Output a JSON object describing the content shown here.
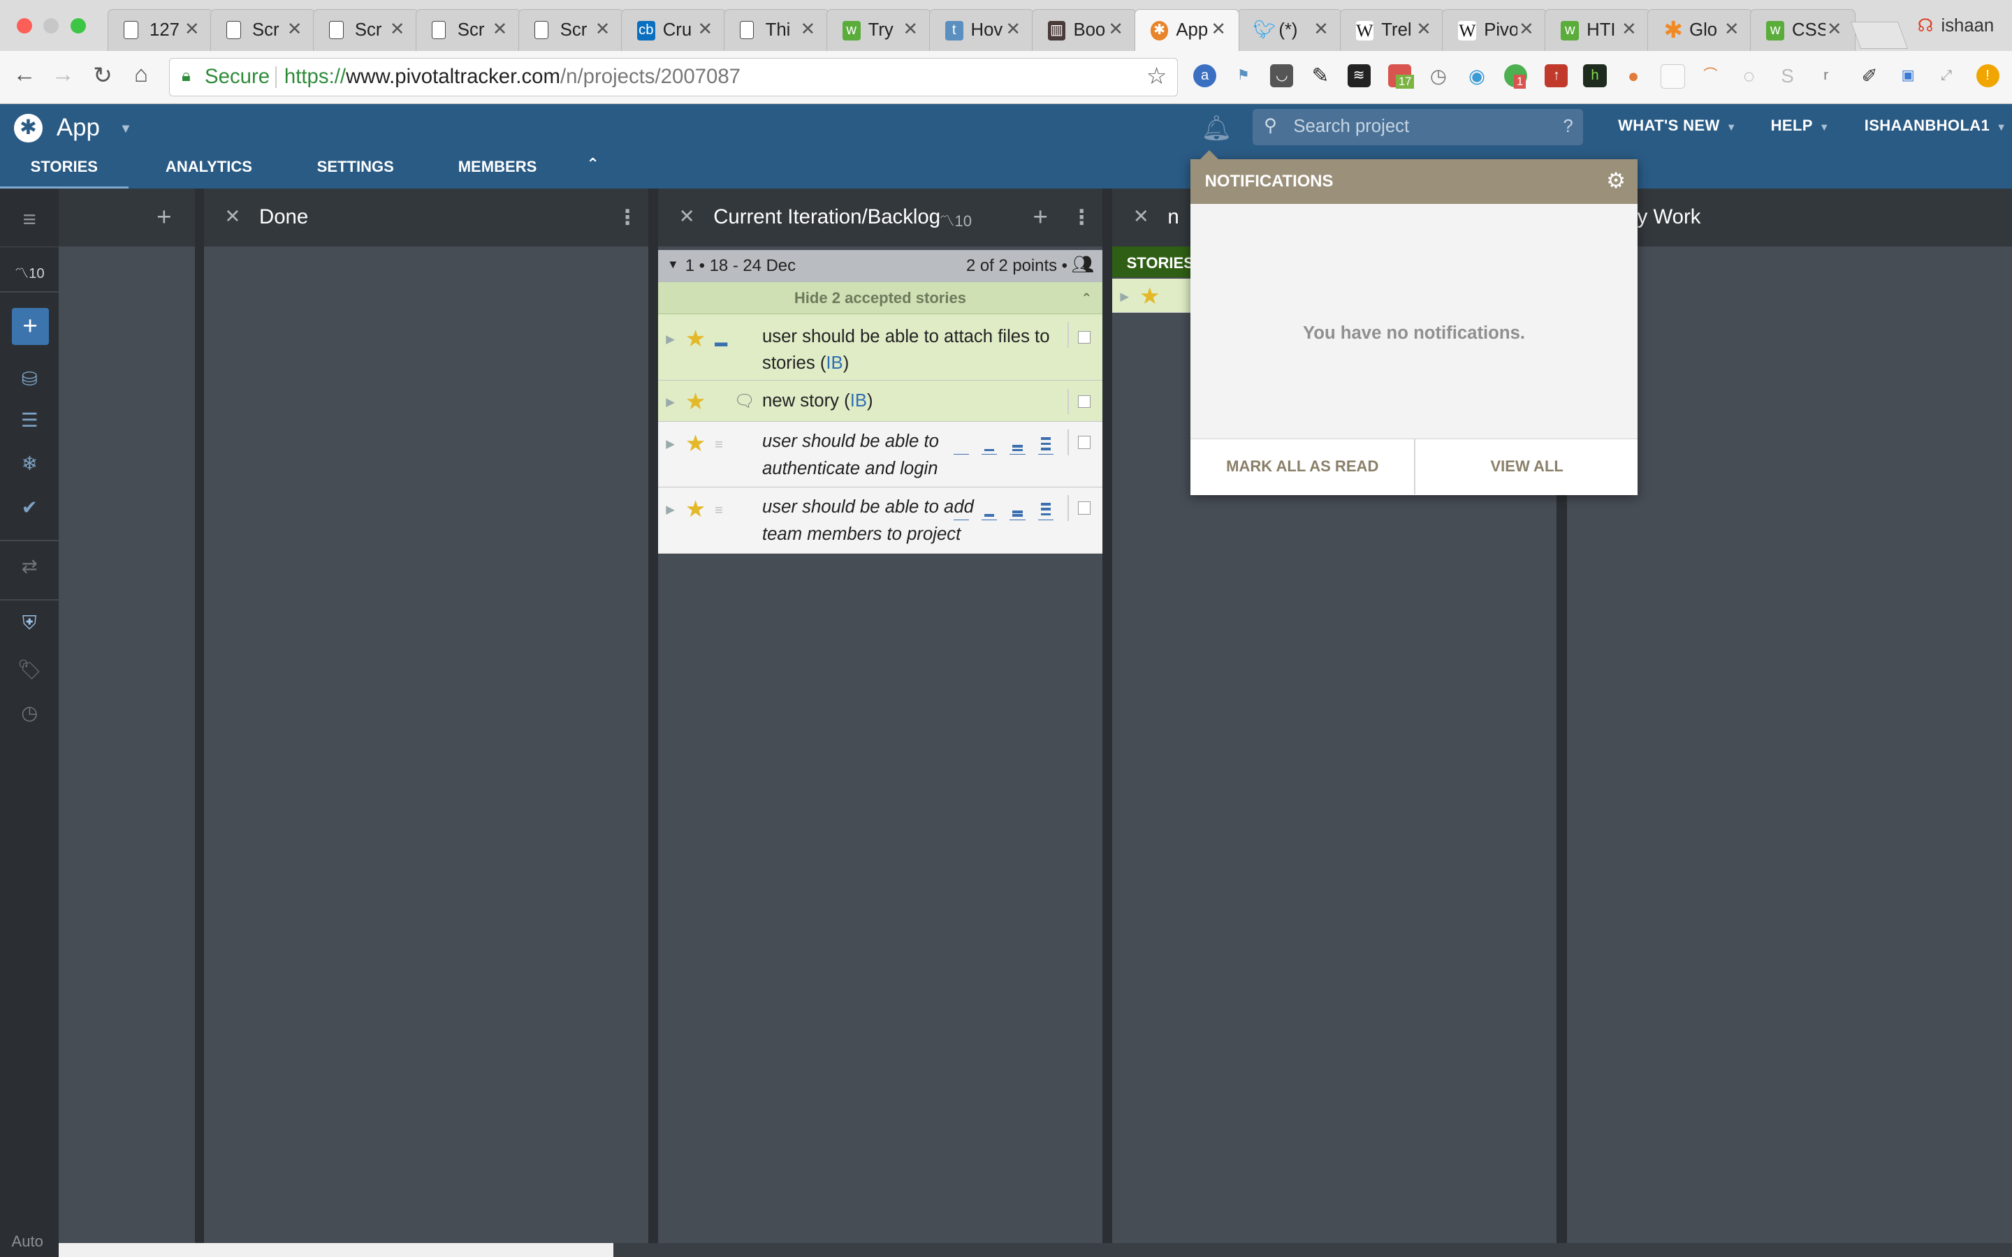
{
  "browser": {
    "tabs": [
      {
        "label": "127",
        "icon": "doc"
      },
      {
        "label": "Scr",
        "icon": "doc"
      },
      {
        "label": "Scr",
        "icon": "doc"
      },
      {
        "label": "Scr",
        "icon": "doc"
      },
      {
        "label": "Scr",
        "icon": "doc"
      },
      {
        "label": "Cru",
        "icon": "cb"
      },
      {
        "label": "Thi",
        "icon": "doc"
      },
      {
        "label": "Try",
        "icon": "w3"
      },
      {
        "label": "Hov",
        "icon": "t"
      },
      {
        "label": "Boo",
        "icon": "trello"
      },
      {
        "label": "App",
        "icon": "tracker"
      },
      {
        "label": "(*)",
        "icon": "twitter"
      },
      {
        "label": "Trel",
        "icon": "wiki"
      },
      {
        "label": "Pivo",
        "icon": "wiki"
      },
      {
        "label": "HTI",
        "icon": "w3"
      },
      {
        "label": "Glo",
        "icon": "asterisk"
      },
      {
        "label": "CSS",
        "icon": "w3"
      }
    ],
    "profile_name": "ishaan",
    "secure_label": "Secure",
    "url_scheme": "https://",
    "url_host": "www.pivotaltracker.com",
    "url_path": "/n/projects/2007087",
    "ext_badge_calendar": "17",
    "ext_badge_green": "1"
  },
  "app": {
    "name": "App",
    "search_placeholder": "Search project",
    "search_help": "?",
    "nav": {
      "whats_new": "WHAT'S NEW",
      "help": "HELP",
      "user": "ISHAANBHOLA1"
    },
    "tabs": {
      "stories": "STORIES",
      "analytics": "ANALYTICS",
      "settings": "SETTINGS",
      "members": "MEMBERS"
    },
    "velocity": "10",
    "auto_label": "Auto"
  },
  "panels": {
    "done": {
      "title": "Done"
    },
    "current": {
      "title": "Current Iteration/Backlog",
      "velocity": "10",
      "iteration_label": "1 • 18 - 24 Dec",
      "points_label": "2 of 2 points •",
      "accepted_toggle": "Hide 2 accepted stories",
      "stories": [
        {
          "title": "user should be able to attach files to stories",
          "owner": "IB",
          "state": "accepted"
        },
        {
          "title": "new story",
          "owner": "IB",
          "state": "accepted"
        },
        {
          "title": "user should be able to authenticate and login in",
          "owner": "",
          "state": "unestimated"
        },
        {
          "title": "user should be able to add team members to project",
          "owner": "",
          "state": "unestimated"
        }
      ]
    },
    "partial_left": {
      "title": "n",
      "stories_label": "STORIES"
    },
    "my_work": {
      "title": "y Work"
    }
  },
  "notifications": {
    "title": "NOTIFICATIONS",
    "empty_text": "You have no notifications.",
    "mark_all_read": "MARK ALL AS READ",
    "view_all": "VIEW ALL"
  }
}
